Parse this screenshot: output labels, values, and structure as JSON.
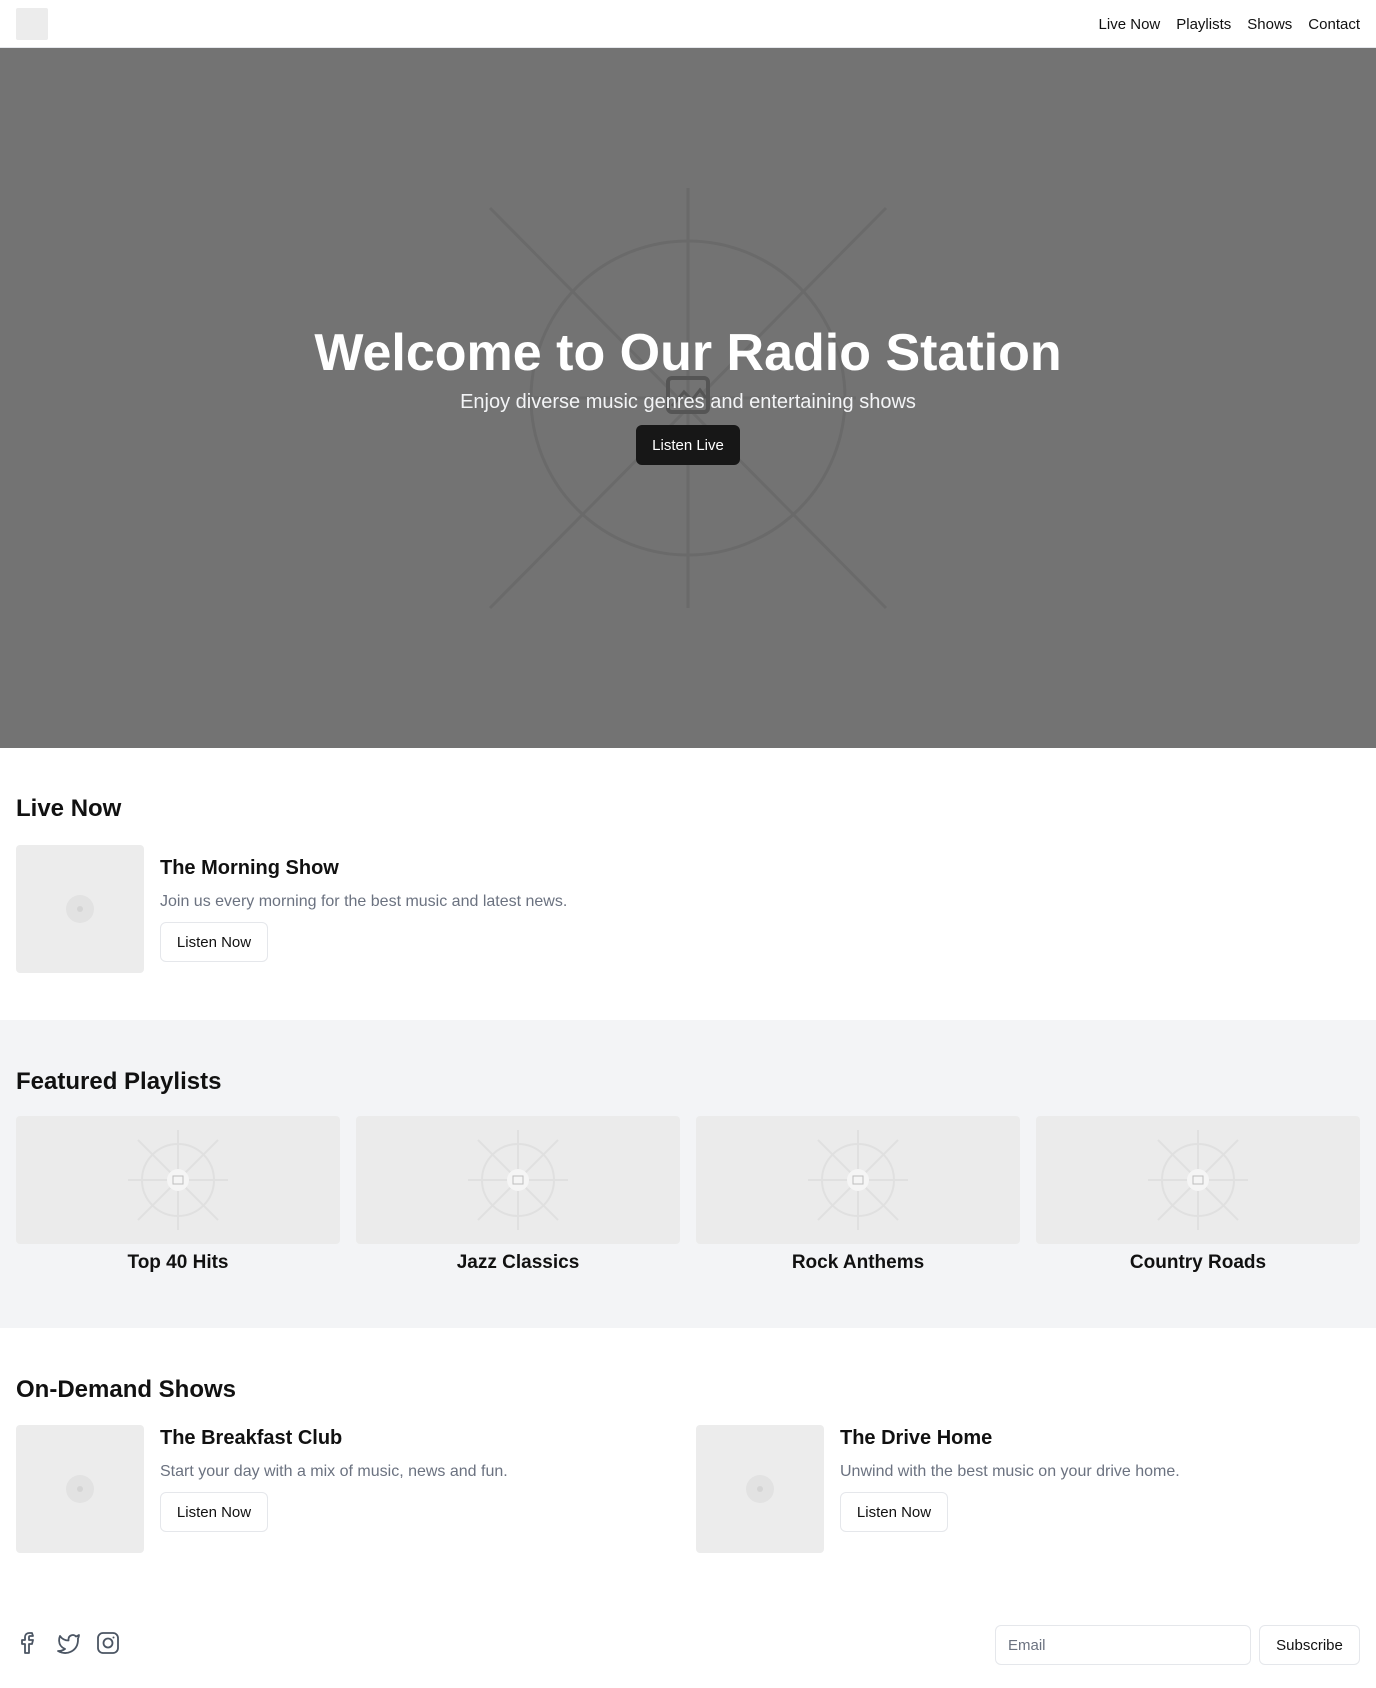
{
  "header": {
    "nav": [
      "Live Now",
      "Playlists",
      "Shows",
      "Contact"
    ]
  },
  "hero": {
    "title": "Welcome to Our Radio Station",
    "subtitle": "Enjoy diverse music genres and entertaining shows",
    "button": "Listen Live"
  },
  "live_now": {
    "heading": "Live Now",
    "show": {
      "name": "The Morning Show",
      "description": "Join us every morning for the best music and latest news.",
      "button": "Listen Now"
    }
  },
  "playlists": {
    "heading": "Featured Playlists",
    "items": [
      "Top 40 Hits",
      "Jazz Classics",
      "Rock Anthems",
      "Country Roads"
    ]
  },
  "shows": {
    "heading": "On-Demand Shows",
    "items": [
      {
        "name": "The Breakfast Club",
        "description": "Start your day with a mix of music, news and fun.",
        "button": "Listen Now"
      },
      {
        "name": "The Drive Home",
        "description": "Unwind with the best music on your drive home.",
        "button": "Listen Now"
      }
    ]
  },
  "footer": {
    "social": [
      "facebook-icon",
      "twitter-icon",
      "instagram-icon"
    ],
    "email_placeholder": "Email",
    "subscribe": "Subscribe"
  },
  "colors": {
    "hero_bg": "#737373",
    "primary_button": "#171717",
    "section_alt_bg": "#f3f4f6",
    "placeholder_bg": "#ececec",
    "muted_text": "#6b7280"
  }
}
